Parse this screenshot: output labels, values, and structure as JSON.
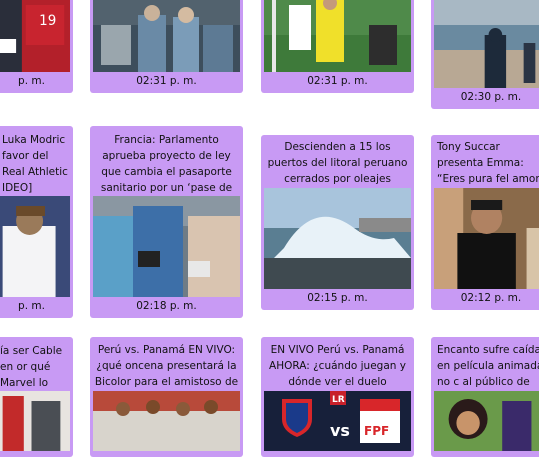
{
  "cards": [
    {
      "title": "",
      "time": "p. m."
    },
    {
      "title": "",
      "time": "02:31 p. m."
    },
    {
      "title": "",
      "time": "02:31 p. m."
    },
    {
      "title": "",
      "time": "02:30 p. m."
    },
    {
      "title": "Luka Modric favor del Real Athletic IDEO]",
      "time": "p. m."
    },
    {
      "title": "Francia: Parlamento aprueba proyecto de ley que cambia el pasaporte sanitario por un ‘pase de vacunación’",
      "time": "02:18 p. m."
    },
    {
      "title": "Descienden a 15 los puertos del litoral peruano cerrados por oleajes anómalos",
      "time": "02:15 p. m."
    },
    {
      "title": "Tony Succar presenta Emma: “Eres pura fel amor”",
      "time": "02:12 p. m."
    },
    {
      "title": "ía ser Cable en or qué Marvel lo ozó?",
      "time": ""
    },
    {
      "title": "Perú vs. Panamá EN VIVO: ¿qué oncena presentará la Bicolor para el amistoso de HOY?",
      "time": ""
    },
    {
      "title": "EN VIVO Perú vs. Panamá AHORA: ¿cuándo juegan y dónde ver el duelo amistoso?",
      "time": ""
    },
    {
      "title": "Encanto sufre caída en película animada no c al público de Ch",
      "time": ""
    }
  ],
  "logos": {
    "lr": "LR",
    "vs": "vs",
    "fpf": "FPF"
  },
  "jersey_number": "19"
}
